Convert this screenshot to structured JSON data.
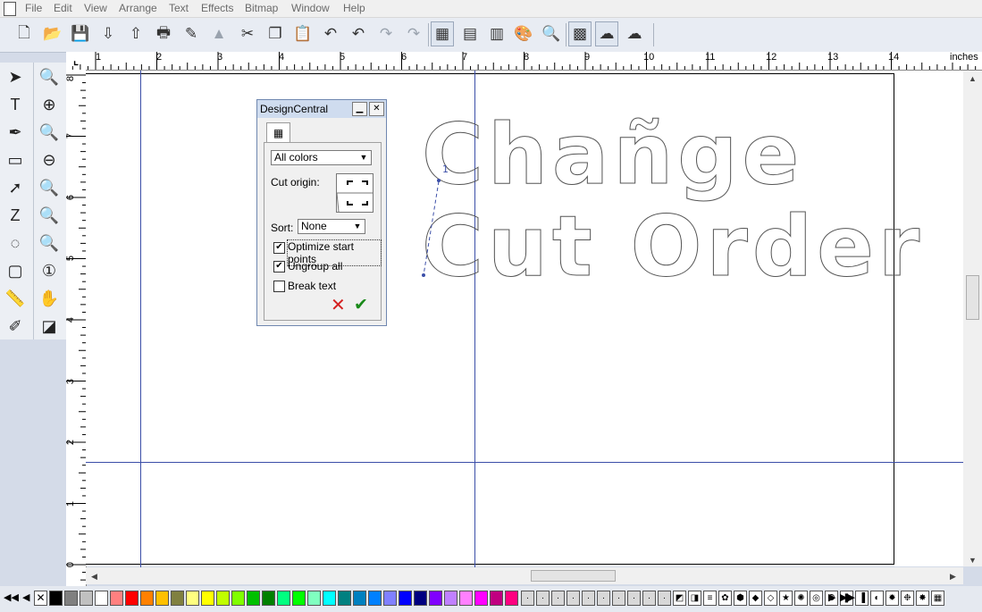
{
  "menu": [
    "File",
    "Edit",
    "View",
    "Arrange",
    "Text",
    "Effects",
    "Bitmap",
    "Window",
    "Help"
  ],
  "ruler": {
    "unit": "inches",
    "h_labels": [
      "1",
      "2",
      "3",
      "4",
      "5",
      "6",
      "7",
      "8",
      "9",
      "10",
      "11",
      "12",
      "13",
      "14"
    ],
    "v_labels": [
      "8",
      "7",
      "6",
      "5",
      "4",
      "3",
      "2",
      "1",
      "0"
    ]
  },
  "design_central": {
    "title": "DesignCentral",
    "min_glyph": "▁",
    "close_glyph": "✕",
    "color_filter": "All colors",
    "cut_origin_label": "Cut origin:",
    "sort_label": "Sort:",
    "sort_value": "None",
    "options": [
      {
        "label": "Optimize start points",
        "checked": true
      },
      {
        "label": "Ungroup all",
        "checked": true
      },
      {
        "label": "Break text",
        "checked": false
      }
    ],
    "cancel_glyph": "✕",
    "ok_glyph": "✔",
    "cancel_color": "#d42020",
    "ok_color": "#1a8a1a"
  },
  "design_text": {
    "line1": "Chañge",
    "line2": "Cut Order",
    "start_marker": "1"
  },
  "colors": {
    "guide": "#3b4ea8",
    "outline": "#555555"
  },
  "palette": [
    "#000000",
    "#808080",
    "#c0c0c0",
    "#ffffff",
    "#ff8080",
    "#ff0000",
    "#ff8000",
    "#ffc000",
    "#808040",
    "#ffff80",
    "#ffff00",
    "#c0ff00",
    "#80ff00",
    "#00c000",
    "#008000",
    "#00ff80",
    "#00ff00",
    "#80ffc0",
    "#00ffff",
    "#008080",
    "#0080c0",
    "#0080ff",
    "#8080ff",
    "#0000ff",
    "#000080",
    "#8000ff",
    "#c080ff",
    "#ff80ff",
    "#ff00ff",
    "#c00080",
    "#ff0080"
  ]
}
